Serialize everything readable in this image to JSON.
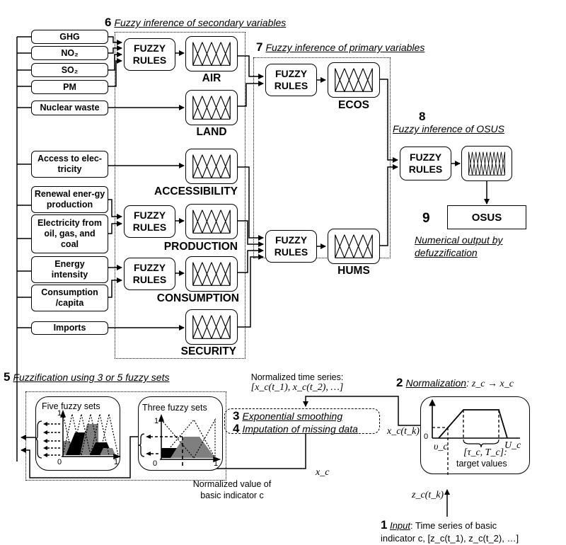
{
  "stages": {
    "s6": {
      "num": "6",
      "title": "Fuzzy inference of secondary variables"
    },
    "s7": {
      "num": "7",
      "title": "Fuzzy inference of primary variables"
    },
    "s8": {
      "num": "8",
      "title": "Fuzzy inference of OSUS"
    },
    "s9": {
      "num": "9",
      "title_line1": "Numerical output by",
      "title_line2": "defuzzification"
    },
    "s5": {
      "num": "5",
      "title": "Fuzzification using 3 or 5 fuzzy sets"
    },
    "s3": {
      "num": "3",
      "title": "Exponential smoothing"
    },
    "s4": {
      "num": "4",
      "title": "Imputation of missing data"
    },
    "s2": {
      "num": "2",
      "title": "Normalization",
      "formula": "z_c → x_c"
    },
    "s1": {
      "num": "1",
      "title": "Input",
      "desc_line1": ": Time series of basic",
      "desc_line2": "indicator c,  [z_c(t_1), z_c(t_2), …]"
    }
  },
  "indicators": [
    {
      "label": "GHG"
    },
    {
      "label": "NO₂"
    },
    {
      "label": "SO₂"
    },
    {
      "label": "PM"
    },
    {
      "label": "Nuclear waste"
    },
    {
      "label": "Access to elec-tricity"
    },
    {
      "label": "Renewal ener-gy production"
    },
    {
      "label": "Electricity from oil, gas, and coal"
    },
    {
      "label": "Energy intensity"
    },
    {
      "label": "Consumption /capita"
    },
    {
      "label": "Imports"
    }
  ],
  "rules_label": "FUZZY RULES",
  "secondary_vars": [
    "AIR",
    "LAND",
    "ACCESSIBILITY",
    "PRODUCTION",
    "CONSUMPTION",
    "SECURITY"
  ],
  "primary_vars": [
    "ECOS",
    "HUMS"
  ],
  "output": {
    "label": "OSUS"
  },
  "annotations": {
    "normalized_series_line1": "Normalized time series:",
    "normalized_series_line2": "[x_c(t_1), x_c(t_2), …]",
    "xc_tk": "x_c(t_k)",
    "xc": "x_c",
    "zc_tk": "z_c(t_k)",
    "normalized_value_line1": "Normalized value of",
    "normalized_value_line2": "basic indicator c",
    "five_sets": "Five fuzzy sets",
    "three_sets": "Three fuzzy sets",
    "axis_zero": "0",
    "axis_one": "1",
    "norm_lower": "υ_c",
    "norm_upper": "U_c",
    "norm_target": "[τ_c, T_c]:",
    "norm_target_desc": "target values"
  }
}
